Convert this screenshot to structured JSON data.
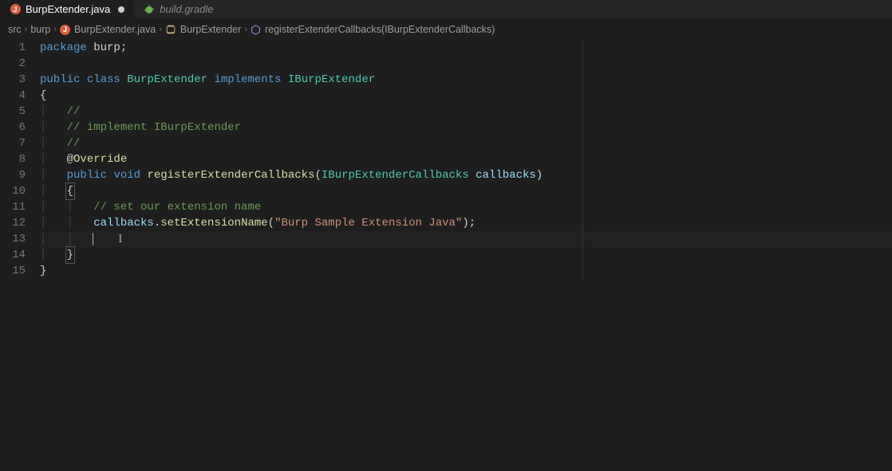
{
  "tabs": [
    {
      "label": "BurpExtender.java",
      "icon": "java",
      "active": true,
      "dirty": true
    },
    {
      "label": "build.gradle",
      "icon": "gradle",
      "active": false,
      "dirty": false
    }
  ],
  "breadcrumb": {
    "segments": [
      {
        "label": "src",
        "icon": null
      },
      {
        "label": "burp",
        "icon": null
      },
      {
        "label": "BurpExtender.java",
        "icon": "java"
      },
      {
        "label": "BurpExtender",
        "icon": "class"
      },
      {
        "label": "registerExtenderCallbacks(IBurpExtenderCallbacks)",
        "icon": "method"
      }
    ]
  },
  "code": {
    "language": "java",
    "line_count": 15,
    "tokens": {
      "l1": {
        "kw": "package",
        "name": " burp",
        "p": ";"
      },
      "l3": {
        "kw1": "public",
        "kw2": "class",
        "cls": "BurpExtender",
        "kw3": "implements",
        "iface": "IBurpExtender"
      },
      "l4": {
        "brace": "{"
      },
      "l5": {
        "c": "//"
      },
      "l6": {
        "c": "// implement IBurpExtender"
      },
      "l7": {
        "c": "//"
      },
      "l8": {
        "at": "@",
        "ann": "Override"
      },
      "l9": {
        "kw1": "public",
        "kw2": "void",
        "fn": "registerExtenderCallbacks",
        "lp": "(",
        "type": "IBurpExtenderCallbacks",
        "arg": "callbacks",
        "rp": ")"
      },
      "l10": {
        "brace": "{"
      },
      "l11": {
        "c": "// set our extension name"
      },
      "l12": {
        "obj": "callbacks",
        "dot": ".",
        "fn": "setExtensionName",
        "lp": "(",
        "str": "\"Burp Sample Extension Java\"",
        "rp": ")",
        "semi": ";"
      },
      "l14": {
        "brace": "}"
      },
      "l15": {
        "brace": "}"
      }
    }
  }
}
